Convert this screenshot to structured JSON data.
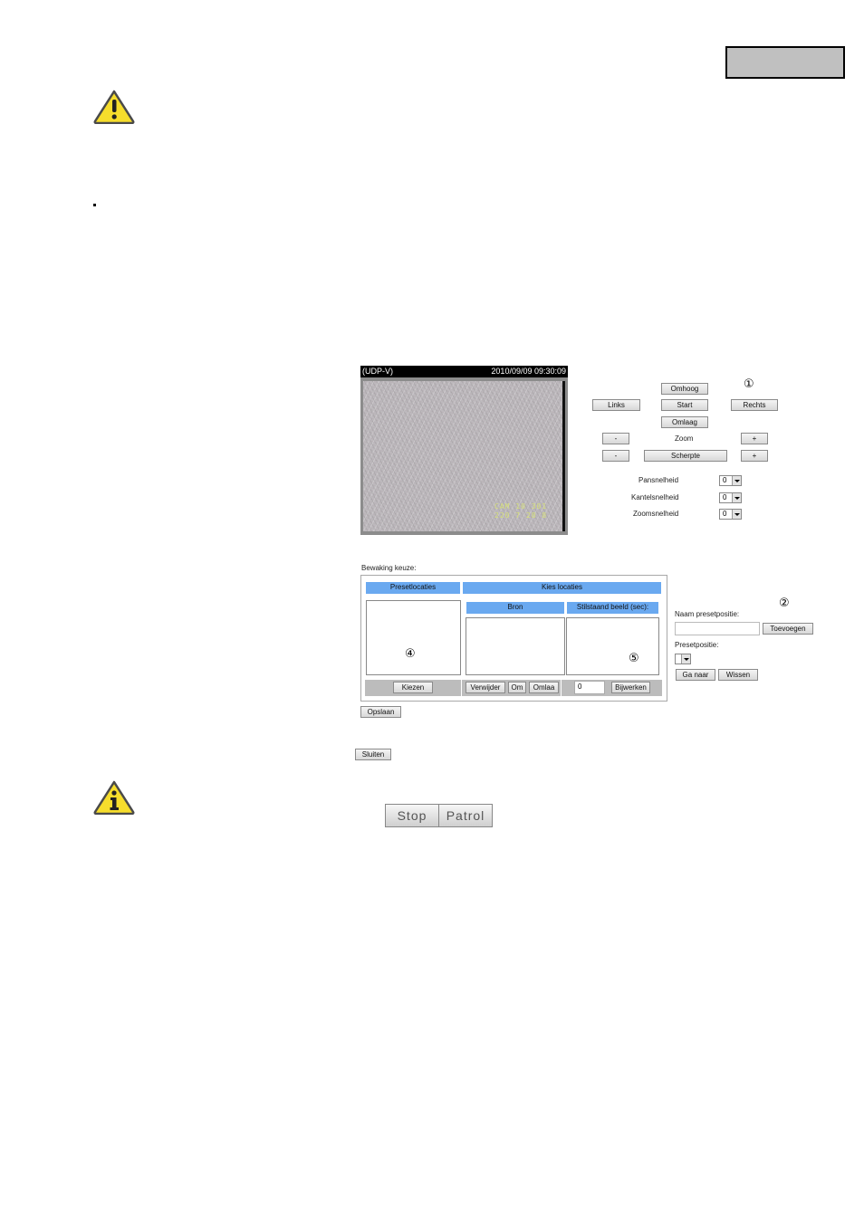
{
  "icons": {
    "warning": "warning-triangle-icon",
    "info": "info-triangle-icon"
  },
  "video": {
    "mode": "(UDP-V)",
    "timestamp": "2010/09/09 09:30:09",
    "osd_line1": "CAM 10 301",
    "osd_line2": "220 7 28 8"
  },
  "ptz": {
    "marker": "①",
    "up": "Omhoog",
    "left": "Links",
    "start": "Start",
    "right": "Rechts",
    "down": "Omlaag",
    "zoom_minus": "-",
    "zoom_label": "Zoom",
    "zoom_plus": "+",
    "focus_minus": "-",
    "focus_label": "Scherpte",
    "focus_plus": "+",
    "speeds": [
      {
        "label": "Pansnelheid",
        "value": "0"
      },
      {
        "label": "Kantelsnelheid",
        "value": "0"
      },
      {
        "label": "Zoomsnelheid",
        "value": "0"
      }
    ]
  },
  "monitor": {
    "title": "Bewaking keuze:",
    "preset_header": "Presetlocaties",
    "choose_header": "Kies locaties",
    "source_header": "Bron",
    "dwell_header": "Stilstaand beeld (sec):",
    "marker_presets": "④",
    "marker_dwell": "⑤",
    "choose_button": "Kiezen",
    "remove_button": "Verwijder",
    "up_button": "Om",
    "down_button": "Omlaa",
    "dwell_value": "0",
    "update_button": "Bijwerken"
  },
  "preset": {
    "marker": "②",
    "name_label": "Naam presetpositie:",
    "name_value": "",
    "add_button": "Toevoegen",
    "position_label": "Presetpositie:",
    "position_value": "",
    "goto_button": "Ga naar",
    "delete_button": "Wissen"
  },
  "save_button": "Opslaan",
  "close_button": "Sluiten",
  "patrol": {
    "stop_button": "Stop",
    "patrol_button": "Patrol"
  }
}
